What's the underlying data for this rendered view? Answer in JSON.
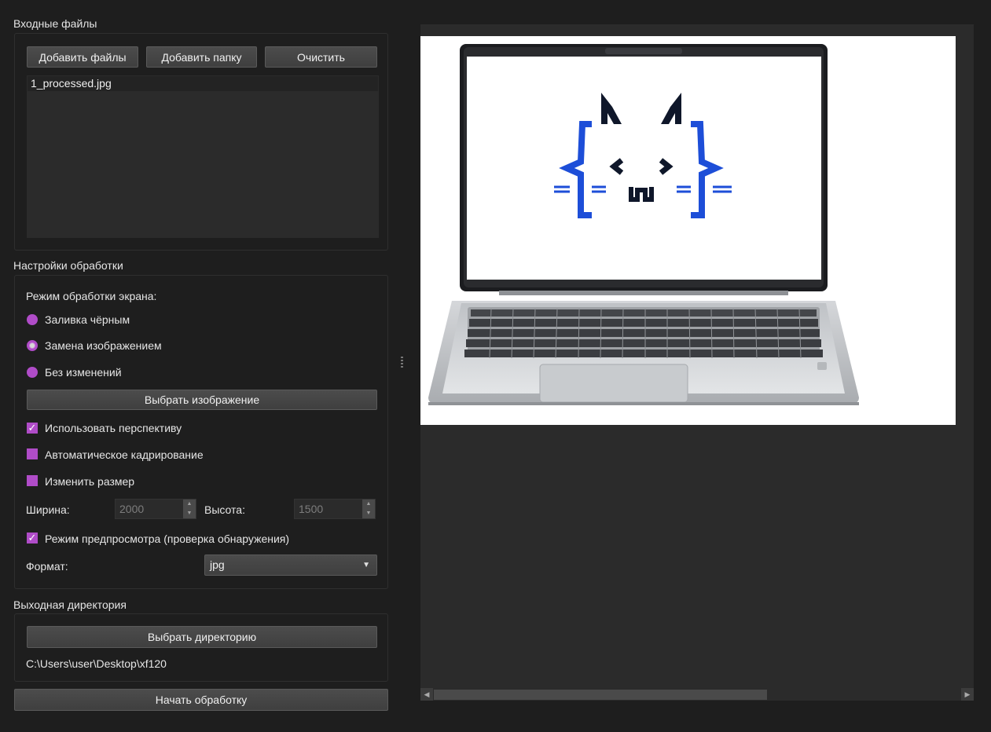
{
  "input_files": {
    "title": "Входные файлы",
    "add_files_label": "Добавить файлы",
    "add_folder_label": "Добавить папку",
    "clear_label": "Очистить",
    "files": [
      "1_processed.jpg"
    ]
  },
  "processing": {
    "title": "Настройки обработки",
    "screen_mode_label": "Режим обработки экрана:",
    "modes": [
      {
        "label": "Заливка чёрным",
        "selected": false
      },
      {
        "label": "Замена изображением",
        "selected": true
      },
      {
        "label": "Без изменений",
        "selected": false
      }
    ],
    "choose_image_label": "Выбрать изображение",
    "use_perspective": {
      "label": "Использовать перспективу",
      "checked": true
    },
    "auto_crop": {
      "label": "Автоматическое кадрирование",
      "checked": false
    },
    "resize": {
      "label": "Изменить размер",
      "checked": false
    },
    "width_label": "Ширина:",
    "width_value": "2000",
    "height_label": "Высота:",
    "height_value": "1500",
    "preview_mode": {
      "label": "Режим предпросмотра (проверка обнаружения)",
      "checked": true
    },
    "format_label": "Формат:",
    "format_value": "jpg"
  },
  "output": {
    "title": "Выходная директория",
    "choose_dir_label": "Выбрать директорию",
    "path": "C:\\Users\\user\\Desktop\\xf120"
  },
  "start_label": "Начать обработку",
  "colors": {
    "accent": "#b04cc8",
    "background": "#1e1e1e",
    "preview_bg": "#2b2b2b",
    "logo_blue": "#1d4ed8",
    "logo_dark": "#0f172a"
  }
}
